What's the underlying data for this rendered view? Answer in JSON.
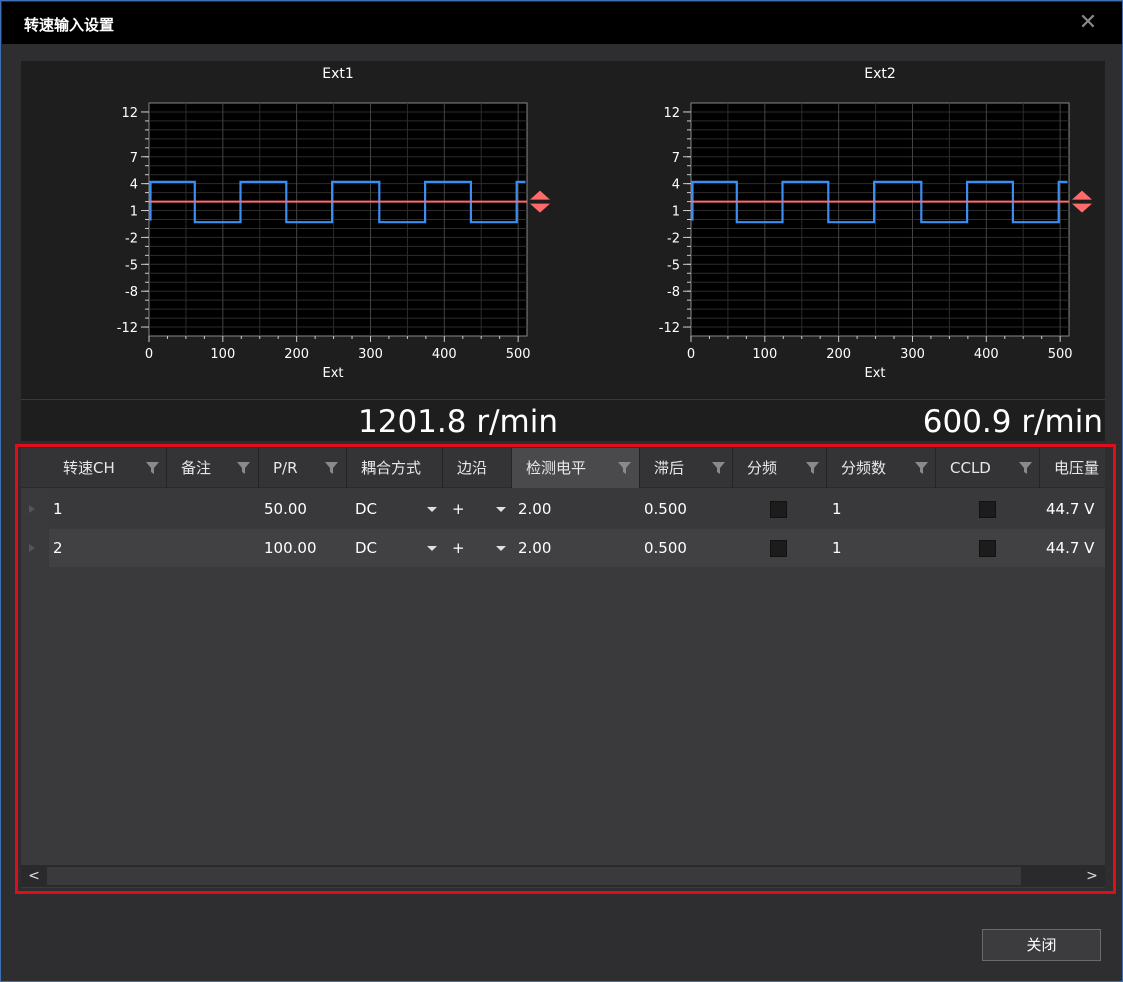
{
  "window": {
    "title": "转速输入设置",
    "close_glyph": "✕"
  },
  "charts": [
    {
      "title": "Ext1",
      "xlabel": "Ext",
      "yticks": [
        "12",
        "7",
        "4",
        "1",
        "-2",
        "-5",
        "-8",
        "-12"
      ],
      "xticks": [
        "0",
        "100",
        "200",
        "300",
        "400",
        "500"
      ],
      "rpm": "1201.8 r/min"
    },
    {
      "title": "Ext2",
      "xlabel": "Ext",
      "yticks": [
        "12",
        "7",
        "4",
        "1",
        "-2",
        "-5",
        "-8",
        "-12"
      ],
      "xticks": [
        "0",
        "100",
        "200",
        "300",
        "400",
        "500"
      ],
      "rpm": "600.9 r/min"
    }
  ],
  "chart_data": [
    {
      "type": "line",
      "title": "Ext1",
      "xlabel": "Ext",
      "xlim": [
        0,
        512
      ],
      "ylim": [
        -13,
        13
      ],
      "grid": true,
      "series": [
        {
          "color": "#3d8ef2",
          "x": [
            0,
            2,
            2,
            62,
            62,
            124,
            124,
            186,
            186,
            248,
            248,
            312,
            312,
            374,
            374,
            436,
            436,
            498,
            498,
            510
          ],
          "y": [
            0,
            0,
            4.2,
            4.2,
            -0.3,
            -0.3,
            4.2,
            4.2,
            -0.3,
            -0.3,
            4.2,
            4.2,
            -0.3,
            -0.3,
            4.2,
            4.2,
            -0.3,
            -0.3,
            4.2,
            4.2
          ]
        },
        {
          "name": "检测电平",
          "color": "#ff6b6b",
          "x": [
            0,
            512
          ],
          "y": [
            2.0,
            2.0
          ]
        }
      ]
    },
    {
      "type": "line",
      "title": "Ext2",
      "xlabel": "Ext",
      "xlim": [
        0,
        512
      ],
      "ylim": [
        -13,
        13
      ],
      "grid": true,
      "series": [
        {
          "color": "#3d8ef2",
          "x": [
            0,
            2,
            2,
            62,
            62,
            124,
            124,
            186,
            186,
            248,
            248,
            312,
            312,
            374,
            374,
            436,
            436,
            498,
            498,
            510
          ],
          "y": [
            0,
            0,
            4.2,
            4.2,
            -0.3,
            -0.3,
            4.2,
            4.2,
            -0.3,
            -0.3,
            4.2,
            4.2,
            -0.3,
            -0.3,
            4.2,
            4.2,
            -0.3,
            -0.3,
            4.2,
            4.2
          ]
        },
        {
          "name": "检测电平",
          "color": "#ff6b6b",
          "x": [
            0,
            512
          ],
          "y": [
            2.0,
            2.0
          ]
        }
      ]
    }
  ],
  "table": {
    "columns": [
      "转速CH",
      "备注",
      "P/R",
      "耦合方式",
      "边沿",
      "检测电平",
      "滞后",
      "分频",
      "分频数",
      "CCLD",
      "电压量"
    ],
    "rows": [
      {
        "ch": "1",
        "note": "",
        "pr": "50.00",
        "coupling": "DC",
        "edge": "+",
        "level": "2.00",
        "hyst": "0.500",
        "div": false,
        "divnum": "1",
        "ccld": false,
        "voltage": "44.7 V"
      },
      {
        "ch": "2",
        "note": "",
        "pr": "100.00",
        "coupling": "DC",
        "edge": "+",
        "level": "2.00",
        "hyst": "0.500",
        "div": false,
        "divnum": "1",
        "ccld": false,
        "voltage": "44.7 V"
      }
    ],
    "scroll_left": "<",
    "scroll_right": ">"
  },
  "buttons": {
    "close": "关闭"
  },
  "colors": {
    "signal": "#3d8ef2",
    "threshold": "#ff6b6b",
    "highlight": "#e00d1a"
  }
}
